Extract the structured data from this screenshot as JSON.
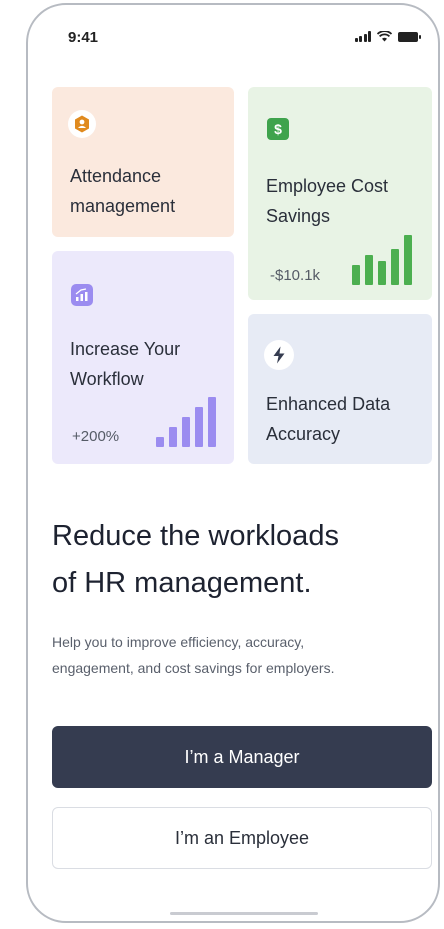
{
  "status_bar": {
    "time": "9:41",
    "icons": [
      "cellular-signal-icon",
      "wifi-icon",
      "battery-icon"
    ]
  },
  "cards": {
    "attendance": {
      "icon": "user-badge-icon",
      "icon_color": "#e08a1e",
      "title_line1": "Attendance",
      "title_line2": "management",
      "background": "#fbe9de"
    },
    "cost_savings": {
      "icon": "dollar-icon",
      "icon_color": "#3fa34d",
      "title_line1": "Employee Cost",
      "title_line2": "Savings",
      "value": "-$10.1k",
      "bar_color": "#4caf50",
      "background": "#e8f3e5"
    },
    "workflow": {
      "icon": "chart-growth-icon",
      "icon_color": "#9b8cf0",
      "title_line1": "Increase Your",
      "title_line2": "Workflow",
      "value": "+200%",
      "bar_color": "#9b8cf0",
      "background": "#ece9fb"
    },
    "accuracy": {
      "icon": "lightning-bolt-icon",
      "icon_color": "#353c50",
      "title_line1": "Enhanced Data",
      "title_line2": "Accuracy",
      "background": "#e7ebf5"
    }
  },
  "headline": {
    "line1": "Reduce the workloads",
    "line2": "of HR management."
  },
  "subtext": {
    "line1": "Help you to improve efficiency, accuracy,",
    "line2": "engagement, and cost savings for employers."
  },
  "buttons": {
    "manager": "I’m a Manager",
    "employee": "I’m an Employee"
  },
  "colors": {
    "primary_button": "#353c50",
    "text_dark": "#1d2230"
  }
}
